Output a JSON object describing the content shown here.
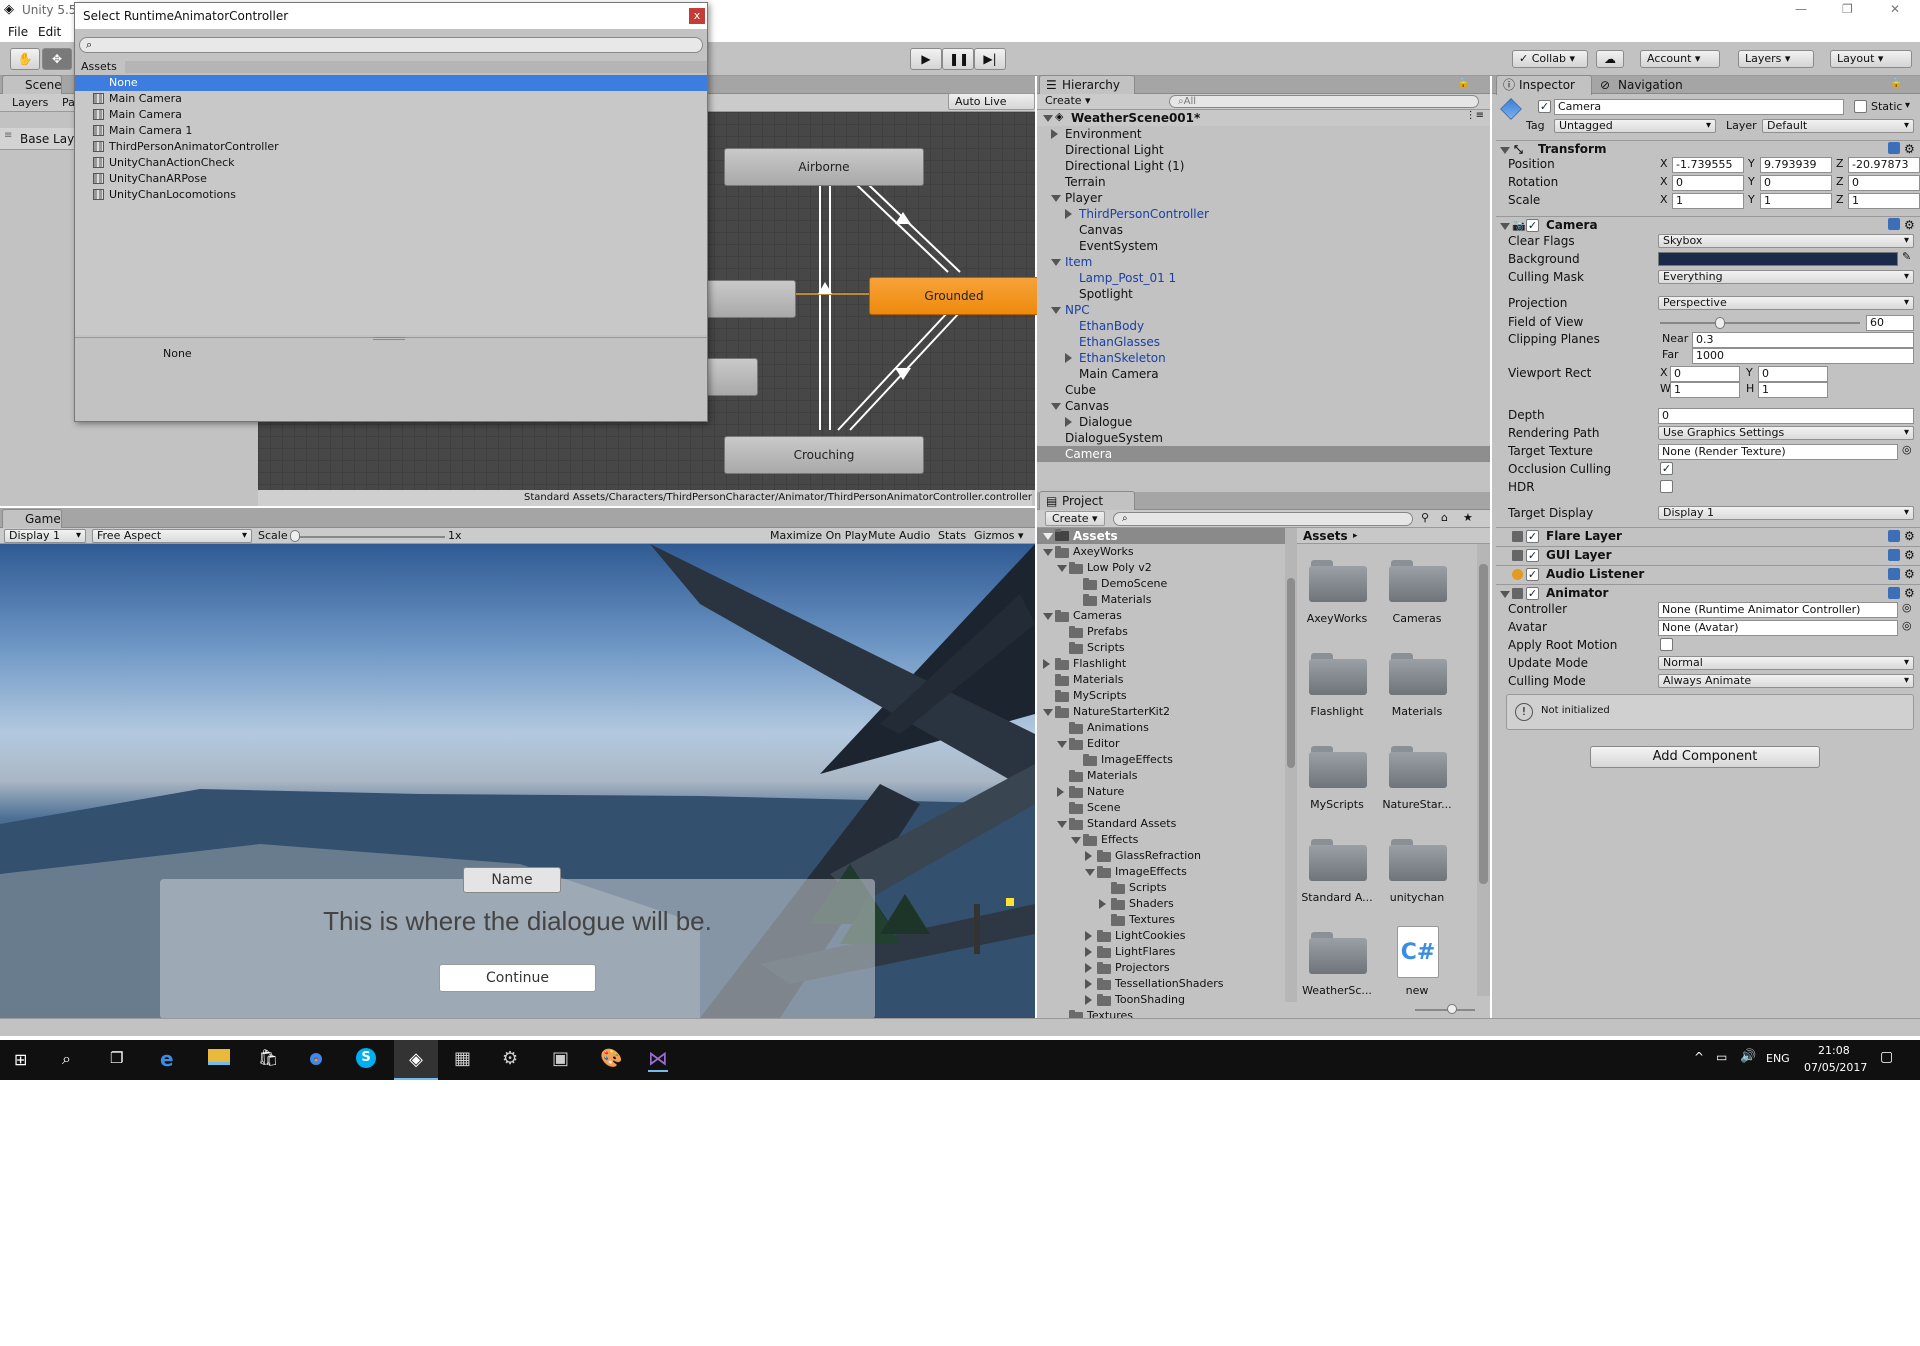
{
  "window": {
    "title": "Unity 5.5.",
    "controls": {
      "min": "—",
      "max": "❐",
      "close": "✕"
    }
  },
  "menu": [
    "File",
    "Edit"
  ],
  "toolbar": {
    "collab": "Collab",
    "account": "Account",
    "layers": "Layers",
    "layout": "Layout"
  },
  "dialog": {
    "title": "Select RuntimeAnimatorController",
    "close": "x",
    "search_value": "",
    "tab": "Assets",
    "items": [
      "None",
      "Main Camera",
      "Main Camera",
      "Main Camera 1",
      "ThirdPersonAnimatorController",
      "UnityChanActionCheck",
      "UnityChanARPose",
      "UnityChanLocomotions"
    ],
    "selected_index": 0,
    "preview_label": "None"
  },
  "animator": {
    "tab": "Scene",
    "subtabs": [
      "Layers",
      "Pa"
    ],
    "base_layer": "Base Lay",
    "auto_live_link": "Auto Live Link",
    "nodes": [
      "Airborne",
      "Grounded",
      "Crouching"
    ],
    "path": "Standard Assets/Characters/ThirdPersonCharacter/Animator/ThirdPersonAnimatorController.controller"
  },
  "game": {
    "tab": "Game",
    "display": "Display 1",
    "aspect": "Free Aspect",
    "scale_label": "Scale",
    "scale_value": "1x",
    "buttons": [
      "Maximize On Play",
      "Mute Audio",
      "Stats",
      "Gizmos"
    ],
    "dialogue_name": "Name",
    "dialogue_text": "This is where the dialogue will be.",
    "continue": "Continue"
  },
  "hierarchy": {
    "tab": "Hierarchy",
    "create": "Create",
    "search_placeholder": "All",
    "scene": "WeatherScene001*",
    "items": [
      {
        "label": "Environment",
        "depth": 0,
        "arrow": "right",
        "blue": false
      },
      {
        "label": "Directional Light",
        "depth": 0,
        "arrow": "",
        "blue": false
      },
      {
        "label": "Directional Light (1)",
        "depth": 0,
        "arrow": "",
        "blue": false
      },
      {
        "label": "Terrain",
        "depth": 0,
        "arrow": "",
        "blue": false
      },
      {
        "label": "Player",
        "depth": 0,
        "arrow": "down",
        "blue": false
      },
      {
        "label": "ThirdPersonController",
        "depth": 1,
        "arrow": "right",
        "blue": true
      },
      {
        "label": "Canvas",
        "depth": 1,
        "arrow": "",
        "blue": false
      },
      {
        "label": "EventSystem",
        "depth": 1,
        "arrow": "",
        "blue": false
      },
      {
        "label": "Item",
        "depth": 0,
        "arrow": "down",
        "blue": true
      },
      {
        "label": "Lamp_Post_01 1",
        "depth": 1,
        "arrow": "",
        "blue": true
      },
      {
        "label": "Spotlight",
        "depth": 1,
        "arrow": "",
        "blue": false
      },
      {
        "label": "NPC",
        "depth": 0,
        "arrow": "down",
        "blue": true
      },
      {
        "label": "EthanBody",
        "depth": 1,
        "arrow": "",
        "blue": true
      },
      {
        "label": "EthanGlasses",
        "depth": 1,
        "arrow": "",
        "blue": true
      },
      {
        "label": "EthanSkeleton",
        "depth": 1,
        "arrow": "right",
        "blue": true
      },
      {
        "label": "Main Camera",
        "depth": 1,
        "arrow": "",
        "blue": false
      },
      {
        "label": "Cube",
        "depth": 0,
        "arrow": "",
        "blue": false
      },
      {
        "label": "Canvas",
        "depth": 0,
        "arrow": "down",
        "blue": false
      },
      {
        "label": "Dialogue",
        "depth": 1,
        "arrow": "right",
        "blue": false
      },
      {
        "label": "DialogueSystem",
        "depth": 0,
        "arrow": "",
        "blue": false
      },
      {
        "label": "Camera",
        "depth": 0,
        "arrow": "",
        "blue": false,
        "selected": true
      }
    ]
  },
  "project": {
    "tab": "Project",
    "create": "Create",
    "tree_root": "Assets",
    "breadcrumb": "Assets",
    "tree": [
      {
        "label": "AxeyWorks",
        "depth": 1,
        "arrow": "down"
      },
      {
        "label": "Low Poly v2",
        "depth": 2,
        "arrow": "down"
      },
      {
        "label": "DemoScene",
        "depth": 3,
        "arrow": ""
      },
      {
        "label": "Materials",
        "depth": 3,
        "arrow": ""
      },
      {
        "label": "Cameras",
        "depth": 1,
        "arrow": "down"
      },
      {
        "label": "Prefabs",
        "depth": 2,
        "arrow": ""
      },
      {
        "label": "Scripts",
        "depth": 2,
        "arrow": ""
      },
      {
        "label": "Flashlight",
        "depth": 1,
        "arrow": "right"
      },
      {
        "label": "Materials",
        "depth": 1,
        "arrow": ""
      },
      {
        "label": "MyScripts",
        "depth": 1,
        "arrow": ""
      },
      {
        "label": "NatureStarterKit2",
        "depth": 1,
        "arrow": "down"
      },
      {
        "label": "Animations",
        "depth": 2,
        "arrow": ""
      },
      {
        "label": "Editor",
        "depth": 2,
        "arrow": "down"
      },
      {
        "label": "ImageEffects",
        "depth": 3,
        "arrow": ""
      },
      {
        "label": "Materials",
        "depth": 2,
        "arrow": ""
      },
      {
        "label": "Nature",
        "depth": 2,
        "arrow": "right"
      },
      {
        "label": "Scene",
        "depth": 2,
        "arrow": ""
      },
      {
        "label": "Standard Assets",
        "depth": 2,
        "arrow": "down"
      },
      {
        "label": "Effects",
        "depth": 3,
        "arrow": "down"
      },
      {
        "label": "GlassRefraction",
        "depth": 4,
        "arrow": "right"
      },
      {
        "label": "ImageEffects",
        "depth": 4,
        "arrow": "down"
      },
      {
        "label": "Scripts",
        "depth": 5,
        "arrow": ""
      },
      {
        "label": "Shaders",
        "depth": 5,
        "arrow": "right"
      },
      {
        "label": "Textures",
        "depth": 5,
        "arrow": ""
      },
      {
        "label": "LightCookies",
        "depth": 4,
        "arrow": "right"
      },
      {
        "label": "LightFlares",
        "depth": 4,
        "arrow": "right"
      },
      {
        "label": "Projectors",
        "depth": 4,
        "arrow": "right"
      },
      {
        "label": "TessellationShaders",
        "depth": 4,
        "arrow": "right"
      },
      {
        "label": "ToonShading",
        "depth": 4,
        "arrow": "right"
      },
      {
        "label": "Textures",
        "depth": 2,
        "arrow": ""
      }
    ],
    "grid": [
      "AxeyWorks",
      "Cameras",
      "Flashlight",
      "Materials",
      "MyScripts",
      "NatureStar...",
      "Standard A...",
      "unitychan",
      "WeatherSc...",
      "new"
    ]
  },
  "inspector": {
    "tabs": [
      "Inspector",
      "Navigation"
    ],
    "object_name": "Camera",
    "static": "Static",
    "tag_label": "Tag",
    "tag": "Untagged",
    "layer_label": "Layer",
    "layer": "Default",
    "transform": {
      "title": "Transform",
      "position_label": "Position",
      "rotation_label": "Rotation",
      "scale_label": "Scale",
      "position": [
        "-1.739555",
        "9.793939",
        "-20.97873"
      ],
      "rotation": [
        "0",
        "0",
        "0"
      ],
      "scale": [
        "1",
        "1",
        "1"
      ],
      "axes": [
        "X",
        "Y",
        "Z"
      ]
    },
    "camera": {
      "title": "Camera",
      "clear_flags_label": "Clear Flags",
      "clear_flags": "Skybox",
      "background_label": "Background",
      "culling_label": "Culling Mask",
      "culling": "Everything",
      "projection_label": "Projection",
      "projection": "Perspective",
      "fov_label": "Field of View",
      "fov": "60",
      "fov_fraction": 0.3,
      "clipping_label": "Clipping Planes",
      "near_label": "Near",
      "near": "0.3",
      "far_label": "Far",
      "far": "1000",
      "viewport_label": "Viewport Rect",
      "vx": "0",
      "vy": "0",
      "vw": "1",
      "vh": "1",
      "x": "X",
      "y": "Y",
      "w": "W",
      "h": "H",
      "depth_label": "Depth",
      "depth": "0",
      "rendering_label": "Rendering Path",
      "rendering": "Use Graphics Settings",
      "target_texture_label": "Target Texture",
      "target_texture": "None (Render Texture)",
      "occlusion_label": "Occlusion Culling",
      "hdr_label": "HDR",
      "target_display_label": "Target Display",
      "target_display": "Display 1"
    },
    "components": [
      "Flare Layer",
      "GUI Layer",
      "Audio Listener",
      "Animator"
    ],
    "animator": {
      "controller_label": "Controller",
      "controller": "None (Runtime Animator Controller)",
      "avatar_label": "Avatar",
      "avatar": "None (Avatar)",
      "root_motion_label": "Apply Root Motion",
      "update_label": "Update Mode",
      "update": "Normal",
      "culling_label": "Culling Mode",
      "culling": "Always Animate",
      "warning": "Not initialized"
    },
    "add_component": "Add Component"
  },
  "taskbar": {
    "lang": "ENG",
    "time": "21:08",
    "date": "07/05/2017"
  },
  "colors": {
    "accent_select": "#3d7ddf",
    "node_orange": "#f08a0b",
    "bg_gray": "#c2c2c2",
    "camera_bg": "#1a2a4a"
  }
}
